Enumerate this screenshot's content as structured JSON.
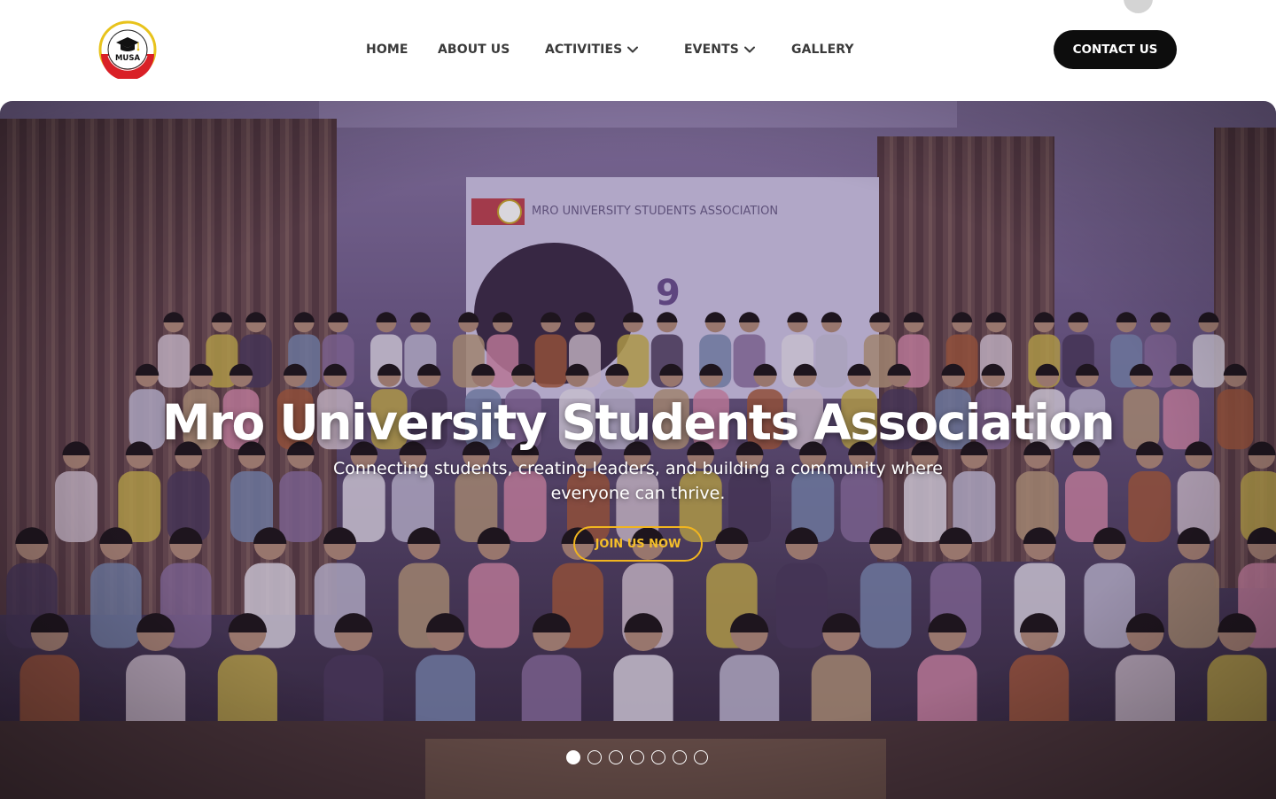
{
  "header": {
    "logo": {
      "name": "musa-logo",
      "text": "MUSA",
      "ring_text": "MRO UNIVERSITY STUDENTS ASSOCIATION"
    },
    "nav": [
      {
        "label": "HOME",
        "has_dropdown": false
      },
      {
        "label": "ABOUT US",
        "has_dropdown": false
      },
      {
        "label": "ACTIVITIES",
        "has_dropdown": true
      },
      {
        "label": "EVENTS",
        "has_dropdown": true
      },
      {
        "label": "GALLERY",
        "has_dropdown": false
      }
    ],
    "contact_label": "CONTACT US"
  },
  "hero": {
    "title": "Mro University Students Association",
    "subtitle": "Connecting students, creating leaders, and building a community where everyone can thrive.",
    "cta_label": "JOIN US NOW",
    "background_image": "group-photo-students",
    "banner_text": "MRO UNIVERSITY STUDENTS ASSOCIATION",
    "slide_count": 7,
    "active_slide": 1
  },
  "colors": {
    "contact_bg": "#0d0d0d",
    "cta_accent": "#f1b51f",
    "nav_text": "#3a3a3a",
    "hero_overlay": "#3b2a55"
  }
}
